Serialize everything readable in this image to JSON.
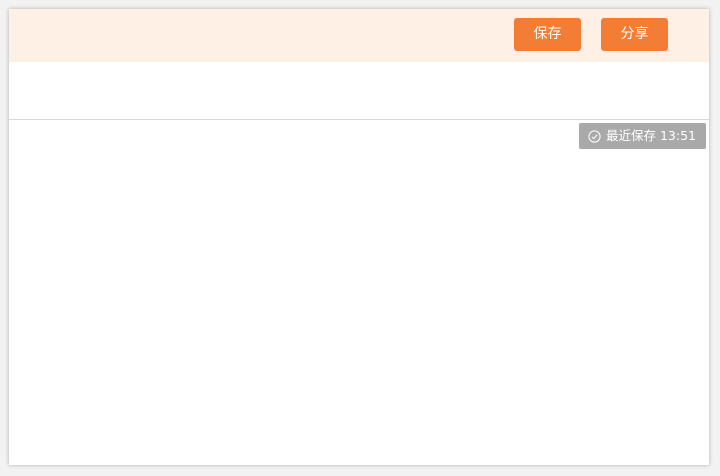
{
  "toolbar": {
    "save_label": "保存",
    "share_label": "分享"
  },
  "status": {
    "icon": "check-circle-icon",
    "text": "最近保存 13:51"
  },
  "colors": {
    "accent": "#f47d36",
    "toolbar_bg": "#fff0e6",
    "status_bg": "#a9a9a9"
  }
}
